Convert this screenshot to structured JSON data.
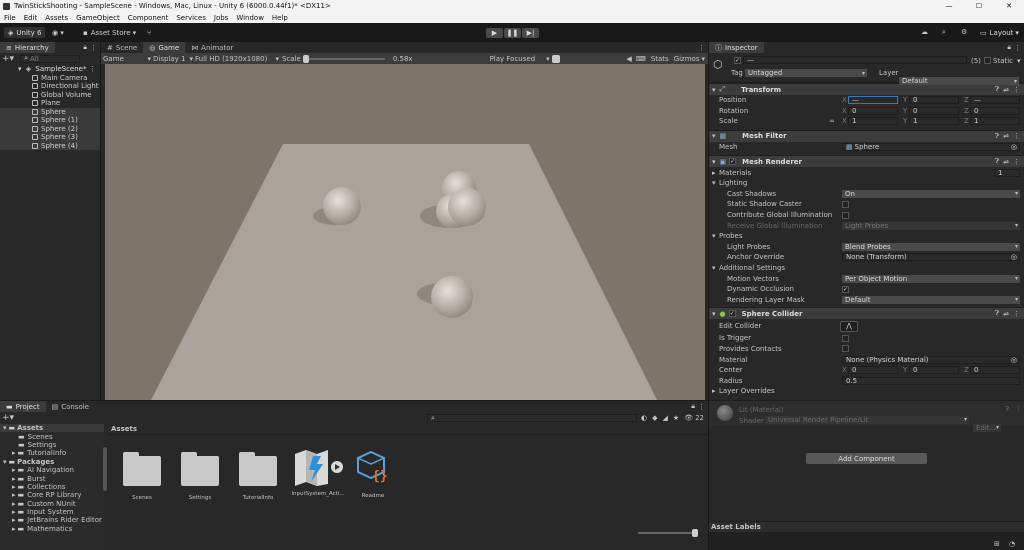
{
  "window": {
    "title": "TwinStickShooting - SampleScene - Windows, Mac, Linux - Unity 6 (6000.0.44f1)* <DX11>",
    "minimize": "—",
    "maximize": "☐",
    "close": "✕"
  },
  "menu": [
    "File",
    "Edit",
    "Assets",
    "GameObject",
    "Component",
    "Services",
    "Jobs",
    "Window",
    "Help"
  ],
  "toolbar": {
    "account": "Unity 6",
    "asset_store": "Asset Store",
    "layout": "Layout"
  },
  "hierarchy": {
    "tab": "Hierarchy",
    "search_placeholder": "All",
    "scene": "SampleScene*",
    "items": [
      "Main Camera",
      "Directional Light",
      "Global Volume",
      "Plane",
      "Sphere",
      "Sphere (1)",
      "Sphere (2)",
      "Sphere (3)",
      "Sphere (4)"
    ]
  },
  "scene_tabs": {
    "scene": "Scene",
    "game": "Game",
    "animator": "Animator"
  },
  "game_bar": {
    "mode": "Game",
    "display": "Display 1",
    "resolution": "Full HD (1920x1080)",
    "scale_label": "Scale",
    "scale_value": "0.58x",
    "play_focused": "Play Focused",
    "stats": "Stats",
    "gizmos": "Gizmos"
  },
  "inspector": {
    "tab": "Inspector",
    "object_name": "—",
    "count": "(5)",
    "static": "Static",
    "tag_label": "Tag",
    "tag_value": "Untagged",
    "layer_label": "Layer",
    "layer_value": "Default",
    "transform": {
      "title": "Transform",
      "position": {
        "label": "Position",
        "x": "—",
        "y": "0",
        "z": "—"
      },
      "rotation": {
        "label": "Rotation",
        "x": "0",
        "y": "0",
        "z": "0"
      },
      "scale": {
        "label": "Scale",
        "x": "1",
        "y": "1",
        "z": "1"
      }
    },
    "mesh_filter": {
      "title": "Mesh Filter",
      "mesh_label": "Mesh",
      "mesh_value": "Sphere"
    },
    "mesh_renderer": {
      "title": "Mesh Renderer",
      "materials": "Materials",
      "materials_count": "1",
      "lighting": "Lighting",
      "cast_shadows": "Cast Shadows",
      "cast_shadows_value": "On",
      "static_shadow": "Static Shadow Caster",
      "contribute_gi": "Contribute Global Illumination",
      "receive_gi": "Receive Global Illumination",
      "receive_gi_value": "Light Probes",
      "probes": "Probes",
      "light_probes": "Light Probes",
      "light_probes_value": "Blend Probes",
      "anchor_override": "Anchor Override",
      "anchor_override_value": "None (Transform)",
      "additional": "Additional Settings",
      "motion_vectors": "Motion Vectors",
      "motion_vectors_value": "Per Object Motion",
      "dynamic_occlusion": "Dynamic Occlusion",
      "rendering_layer_mask": "Rendering Layer Mask",
      "rendering_layer_mask_value": "Default"
    },
    "sphere_collider": {
      "title": "Sphere Collider",
      "edit_collider": "Edit Collider",
      "is_trigger": "Is Trigger",
      "provides_contacts": "Provides Contacts",
      "material": "Material",
      "material_value": "None (Physics Material)",
      "center": "Center",
      "center_x": "0",
      "center_y": "0",
      "center_z": "0",
      "radius": "Radius",
      "radius_value": "0.5",
      "layer_overrides": "Layer Overrides"
    },
    "material": {
      "name": "Lit (Material)",
      "shader_label": "Shader",
      "shader_value": "Universal Render Pipeline/Lit",
      "edit": "Edit..."
    },
    "add_component": "Add Component",
    "asset_labels": "Asset Labels"
  },
  "project": {
    "tab": "Project",
    "console_tab": "Console",
    "count": "22",
    "tree": {
      "assets": "Assets",
      "assets_children": [
        "Scenes",
        "Settings",
        "TutorialInfo"
      ],
      "packages": "Packages",
      "packages_children": [
        "AI Navigation",
        "Burst",
        "Collections",
        "Core RP Library",
        "Custom NUnit",
        "Input System",
        "JetBrains Rider Editor",
        "Mathematics"
      ]
    },
    "breadcrumb": "Assets",
    "items": [
      "Scenes",
      "Settings",
      "TutorialInfo",
      "InputSystem_Acti...",
      "Readme"
    ]
  },
  "colors": {
    "accent": "#2c5d87",
    "background": "#191919",
    "panel": "#282828",
    "game_bg": "#7d746a",
    "plane": "#aaa39c"
  }
}
